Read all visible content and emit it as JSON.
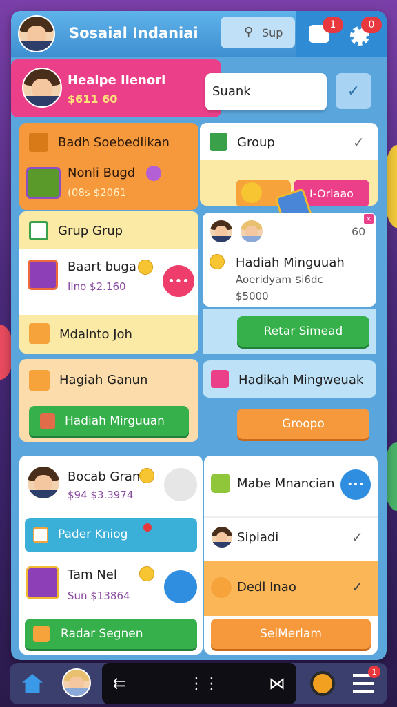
{
  "header": {
    "title": "Sosaial Indaniai",
    "search_label": "Sup",
    "notif_badge_1": "1",
    "notif_badge_2": "0"
  },
  "profile": {
    "name": "Heaipe Ilenori",
    "amount": "$611 60",
    "search_value": "Suank"
  },
  "panel_orange": {
    "title": "Badh Soebedlikan",
    "item_name": "Nonli Bugd",
    "item_price": "(08s $2061"
  },
  "panel_group": {
    "title": "Group",
    "button_label": "I-Orlaao"
  },
  "panel_grup": {
    "title": "Grup Grup",
    "item_name": "Baart buga",
    "item_price": "Ilno $2.160",
    "footer_label": "Mdalnto Joh"
  },
  "panel_hadiah_card": {
    "count": "60",
    "title": "Hadiah Minguuah",
    "line1": "Aoeridyam $i6dc",
    "line2": "$5000"
  },
  "retar_button": "Retar Simead",
  "hadiah_gangun": {
    "title": "Hagiah Ganun",
    "button": "Hadiah Mirguuan"
  },
  "hadikah_card": {
    "title": "Hadikah Mingweuak",
    "button": "Groopo"
  },
  "bottom_left": {
    "row1_name": "Bocab Gran",
    "row1_price": "$94 $3.3974",
    "row2_label": "Pader Kniog",
    "row3_name": "Tam Nel",
    "row3_price": "Sun $13864",
    "button": "Radar Segnen"
  },
  "bottom_right": {
    "row1_name": "Mabe Mnancian",
    "row2_name": "Sipiadi",
    "row3_name": "Dedl Inao",
    "button": "SelMerlam"
  },
  "nav": {
    "badge": "1"
  },
  "colors": {
    "pink": "#ec3f8a",
    "orange": "#f6983c",
    "green": "#35b04a",
    "blue": "#2f8ee0",
    "yellow": "#fbe9a6"
  }
}
